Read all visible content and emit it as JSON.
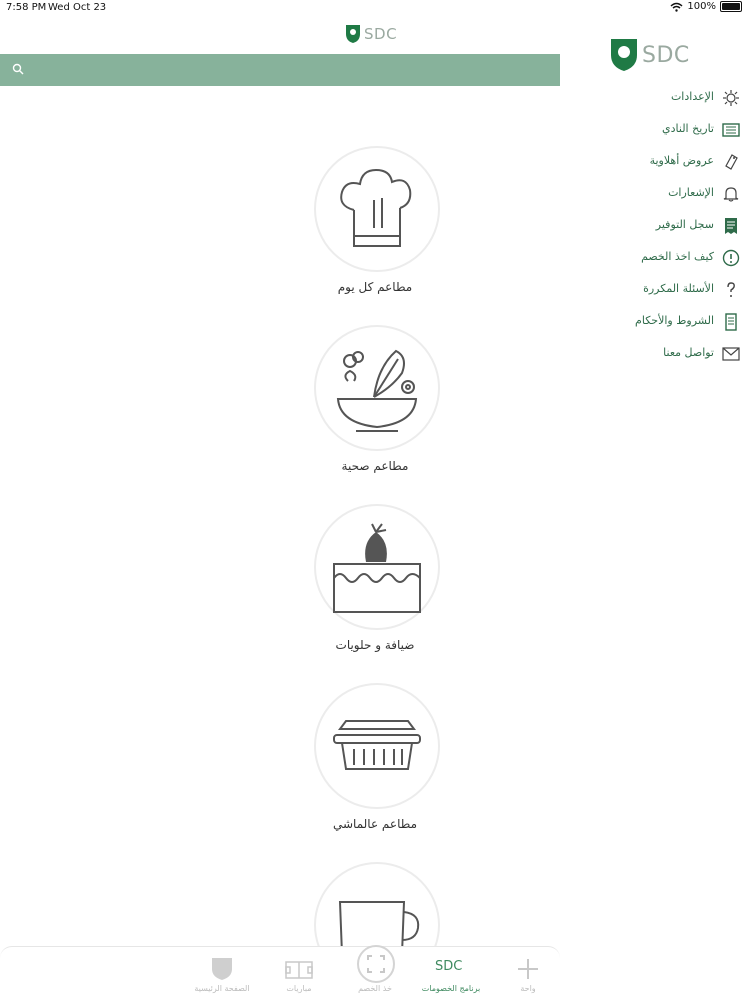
{
  "status": {
    "time": "7:58 PM",
    "date": "Wed Oct 23",
    "battery": "100%"
  },
  "brand": {
    "logo_text": "SDC"
  },
  "search": {
    "placeholder": ""
  },
  "categories": [
    {
      "label": "مطاعم كل يوم",
      "icon": "chef-hat-icon"
    },
    {
      "label": "مطاعم صحية",
      "icon": "salad-bowl-icon"
    },
    {
      "label": "ضيافة و حلويات",
      "icon": "cake-icon"
    },
    {
      "label": "مطاعم عالماشي",
      "icon": "takeaway-box-icon"
    },
    {
      "label": "",
      "icon": "cup-icon"
    }
  ],
  "tabs": [
    {
      "label": "واحة",
      "icon": "plus-icon"
    },
    {
      "label": "برنامج الخصومات",
      "icon": "sdc-logo-icon",
      "active": true
    },
    {
      "label": "خذ الخصم",
      "icon": "scan-icon"
    },
    {
      "label": "مباريات",
      "icon": "field-icon"
    },
    {
      "label": "الصفحة الرئيسية",
      "icon": "shield-icon"
    }
  ],
  "menu": [
    {
      "label": "الإعدادات",
      "icon": "settings-icon"
    },
    {
      "label": "تاريخ النادي",
      "icon": "history-icon"
    },
    {
      "label": "عروض أهلاوية",
      "icon": "offers-icon"
    },
    {
      "label": "الإشعارات",
      "icon": "bell-icon"
    },
    {
      "label": "سجل التوفير",
      "icon": "receipt-icon"
    },
    {
      "label": "كيف اخذ الخصم",
      "icon": "info-icon"
    },
    {
      "label": "الأسئلة المكررة",
      "icon": "question-icon"
    },
    {
      "label": "الشروط والأحكام",
      "icon": "document-icon"
    },
    {
      "label": "تواصل معنا",
      "icon": "mail-icon"
    }
  ],
  "colors": {
    "brand_green": "#3f8a60",
    "search_bar": "#87b29b",
    "text_green": "#2f6b4a"
  }
}
